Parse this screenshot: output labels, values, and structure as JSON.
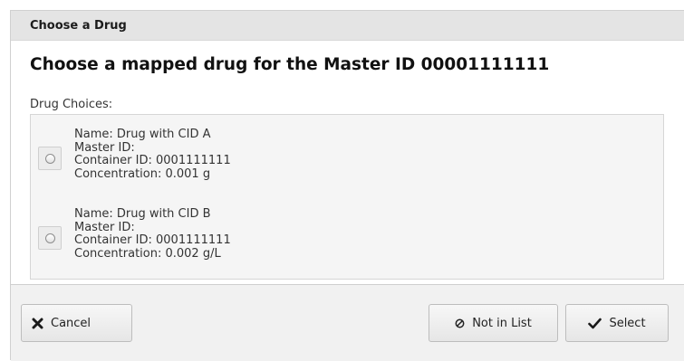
{
  "dialog": {
    "title": "Choose a Drug",
    "heading": "Choose a mapped drug for the Master ID 00001111111",
    "choices_label": "Drug Choices:",
    "choices": [
      {
        "name": "Name: Drug with CID A",
        "master_id": "Master ID:",
        "container_id": "Container ID: 0001111111",
        "concentration": "Concentration: 0.001 g",
        "selected": false
      },
      {
        "name": "Name: Drug with CID B",
        "master_id": "Master ID:",
        "container_id": "Container ID: 0001111111",
        "concentration": "Concentration: 0.002 g/L",
        "selected": false
      }
    ]
  },
  "buttons": {
    "cancel": {
      "label": "Cancel",
      "icon": "close-icon"
    },
    "not_in_list": {
      "label": "Not in List",
      "icon": "prohibited-icon"
    },
    "select": {
      "label": "Select",
      "icon": "checkmark-icon"
    }
  }
}
